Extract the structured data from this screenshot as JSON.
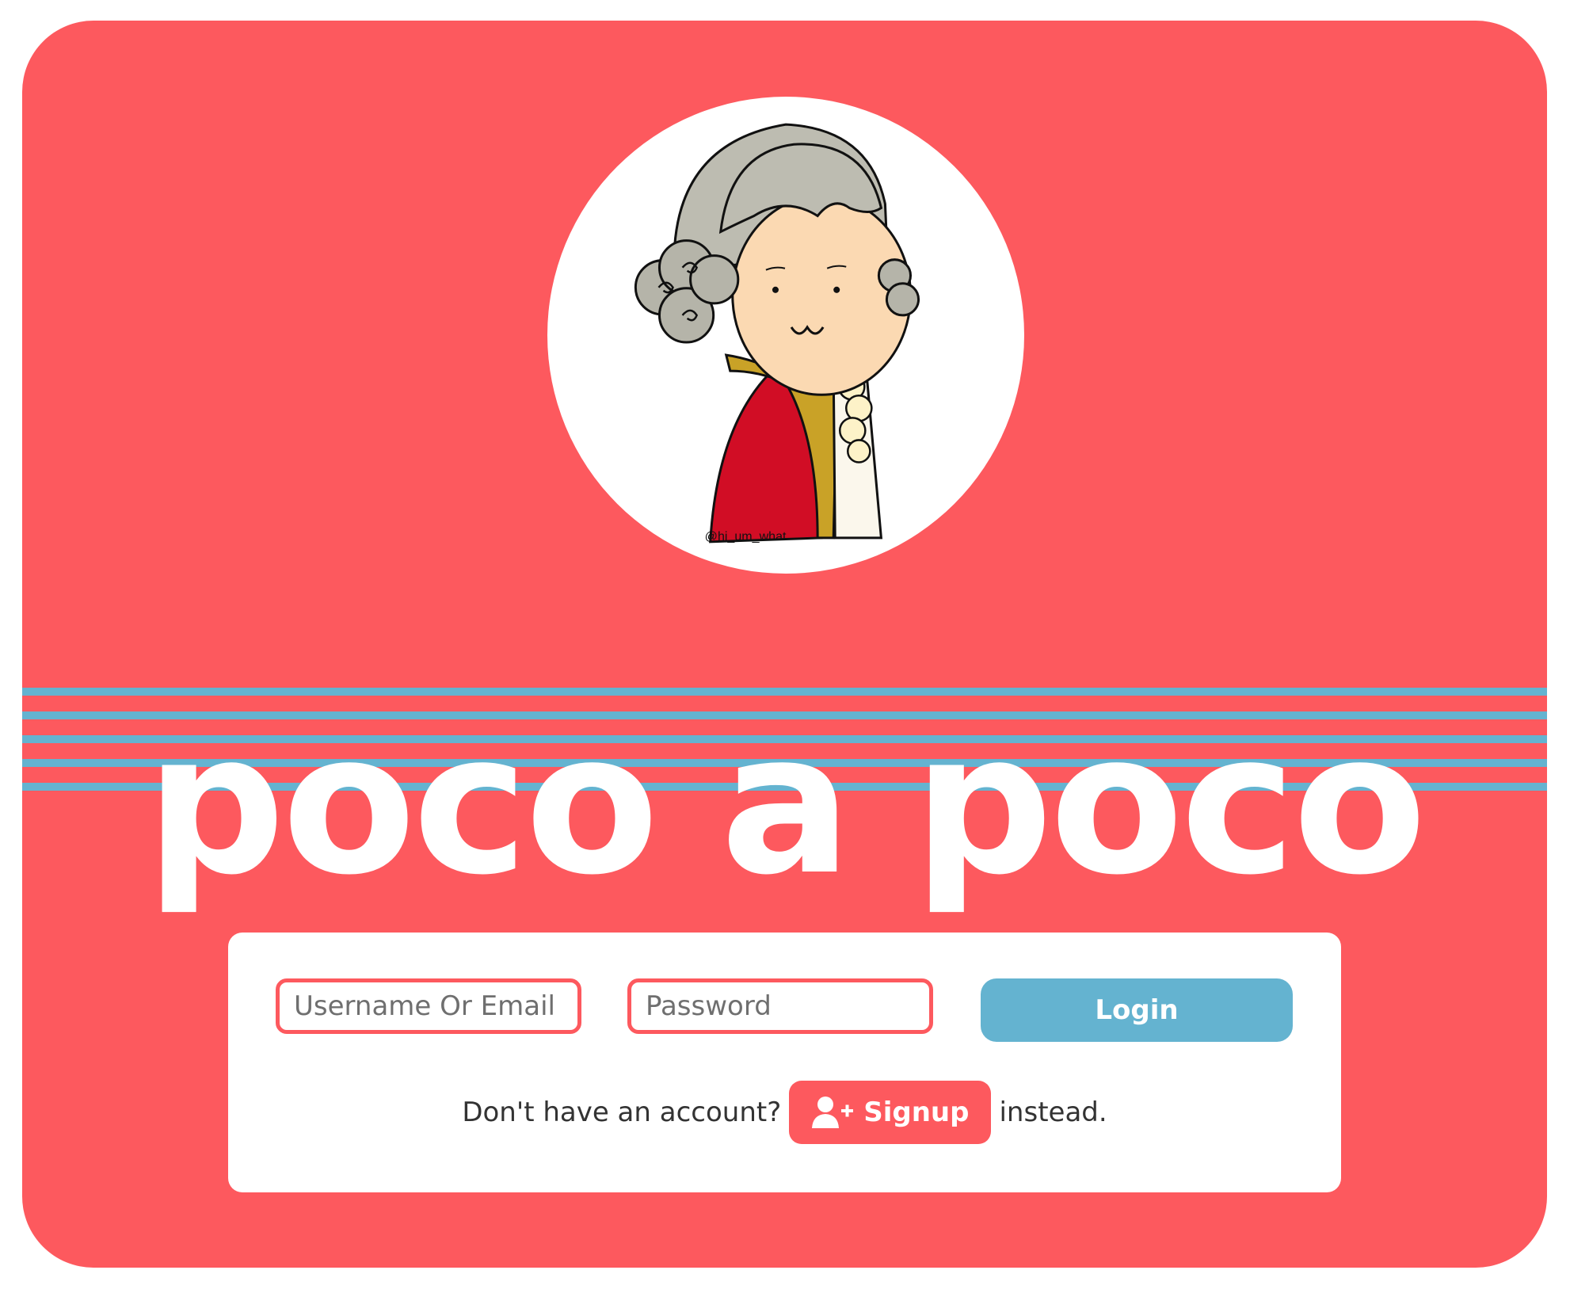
{
  "app": {
    "title": "poco a poco",
    "colors": {
      "background": "#fd595e",
      "staff_lines": "#64b3d0",
      "login_button": "#64b3d0",
      "signup_button": "#fd595e",
      "card": "#ffffff"
    }
  },
  "avatar": {
    "icon": "mozart-cartoon-avatar",
    "credit": "@hi_um_what"
  },
  "login_form": {
    "username": {
      "placeholder": "Username Or Email",
      "value": ""
    },
    "password": {
      "placeholder": "Password",
      "value": ""
    },
    "login_label": "Login"
  },
  "signup": {
    "prefix": "Don't have an account?",
    "button_label": "Signup",
    "button_icon": "user-plus-icon",
    "suffix": "instead."
  }
}
